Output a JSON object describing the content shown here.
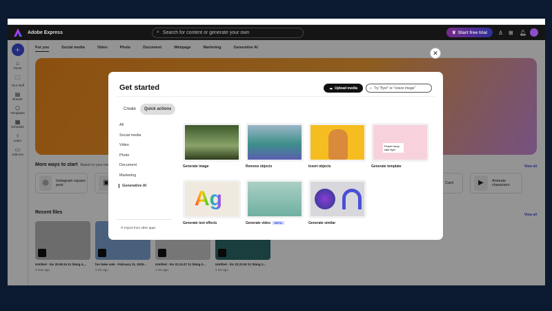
{
  "header": {
    "brand": "Adobe Express",
    "search_placeholder": "Search for content or generate your own",
    "trial_button": "Start free trial"
  },
  "sidebar": {
    "items": [
      {
        "label": "Home",
        "icon": "home-icon"
      },
      {
        "label": "Your stuff",
        "icon": "folder-icon"
      },
      {
        "label": "Brands",
        "icon": "brand-icon"
      },
      {
        "label": "Templates",
        "icon": "templates-icon"
      },
      {
        "label": "Schedule",
        "icon": "calendar-icon"
      },
      {
        "label": "Learn",
        "icon": "lightbulb-icon"
      },
      {
        "label": "Add-ons",
        "icon": "addons-icon"
      }
    ]
  },
  "tabs": [
    "For you",
    "Social media",
    "Video",
    "Photo",
    "Document",
    "Webpage",
    "Marketing",
    "Generative AI"
  ],
  "more_ways": {
    "title": "More ways to start",
    "subtitle": "Based on your inter",
    "view_all": "View all",
    "cards": [
      "Instagram square post",
      "Card",
      "Animate characters"
    ]
  },
  "recent": {
    "title": "Recent files",
    "view_all": "View all",
    "files": [
      {
        "name": "Untitled - lúc 20.08.34 11 tháng 4,...",
        "time": "2 mos ago"
      },
      {
        "name": "fun bake sale - February 11, 2025...",
        "time": "1 mo ago"
      },
      {
        "name": "Untitled - lúc 22.24.37 11 tháng 2...",
        "time": "1 mo ago"
      },
      {
        "name": "Untitled - lúc 22.22.50 11 tháng 2...",
        "time": "1 mo ago"
      }
    ]
  },
  "modal": {
    "title": "Get started",
    "upload": "Upload media",
    "search_placeholder": "Try \"flyer\" or \"resize image\"",
    "tabs": [
      "Create",
      "Quick actions"
    ],
    "categories": [
      "All",
      "Social media",
      "Video",
      "Photo",
      "Document",
      "Marketing",
      "Generative AI"
    ],
    "import": "Import from other apps",
    "tiles": [
      "Generate image",
      "Remove objects",
      "Insert objects",
      "Generate template",
      "Generate text effects",
      "Generate video",
      "Generate similar"
    ],
    "beta": "BETA",
    "template_caption": "Flower shop sale flyer"
  }
}
